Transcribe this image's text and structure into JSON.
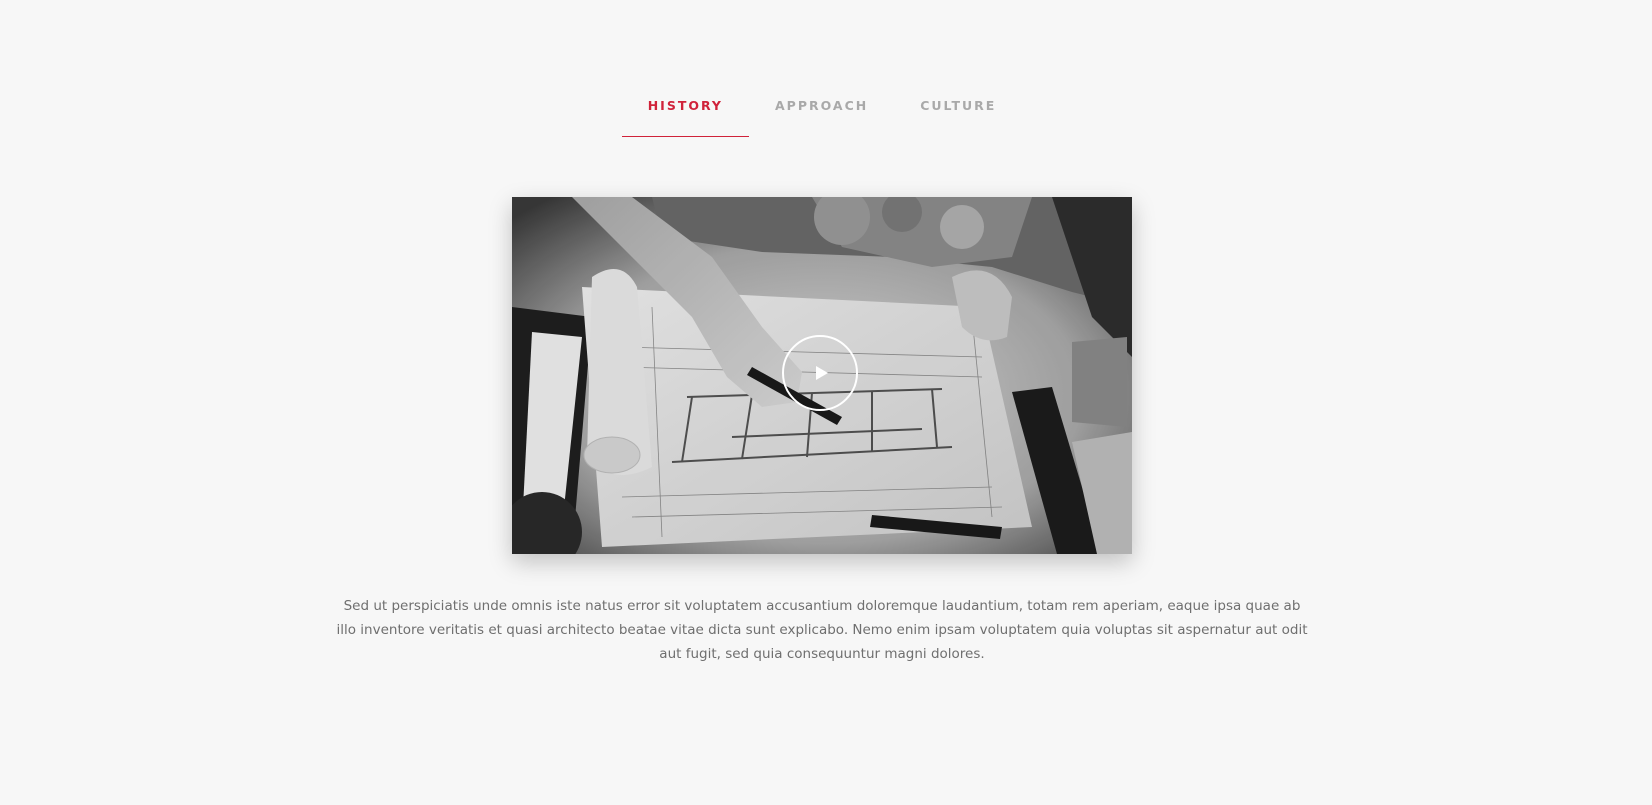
{
  "tabs": [
    {
      "label": "HISTORY",
      "active": true
    },
    {
      "label": "APPROACH",
      "active": false
    },
    {
      "label": "CULTURE",
      "active": false
    }
  ],
  "colors": {
    "accent": "#d0223a",
    "tab_inactive": "#a9a9a9",
    "background": "#f7f7f7",
    "text": "#6f6f6f"
  },
  "video": {
    "icon": "play-icon"
  },
  "description": "Sed ut perspiciatis unde omnis iste natus error sit voluptatem accusantium doloremque laudantium, totam rem aperiam, eaque ipsa quae ab illo inventore veritatis et quasi architecto beatae vitae dicta sunt explicabo. Nemo enim ipsam voluptatem quia voluptas sit aspernatur aut odit aut fugit, sed quia consequuntur magni dolores."
}
